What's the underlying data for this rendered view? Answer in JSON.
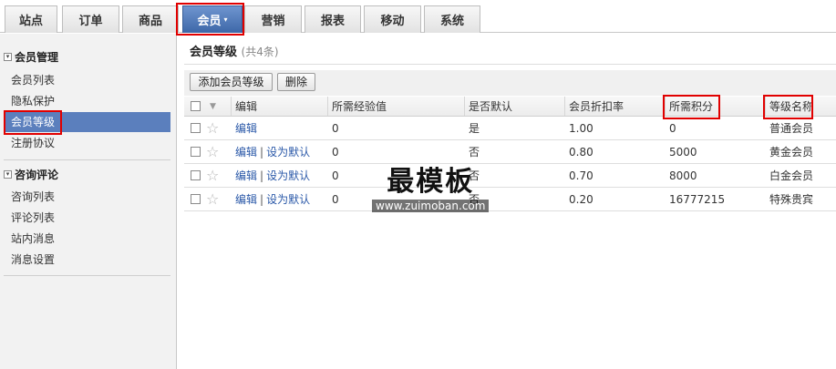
{
  "nav": {
    "tabs": [
      {
        "label": "站点"
      },
      {
        "label": "订单"
      },
      {
        "label": "商品"
      },
      {
        "label": "会员",
        "caret": "▾"
      },
      {
        "label": "营销"
      },
      {
        "label": "报表"
      },
      {
        "label": "移动"
      },
      {
        "label": "系统"
      }
    ],
    "active_index": 3
  },
  "sidebar": {
    "groups": [
      {
        "title": "会员管理",
        "toggle": "▾",
        "items": [
          {
            "label": "会员列表"
          },
          {
            "label": "隐私保护"
          },
          {
            "label": "会员等级",
            "active": true
          },
          {
            "label": "注册协议"
          }
        ]
      },
      {
        "title": "咨询评论",
        "toggle": "▾",
        "items": [
          {
            "label": "咨询列表"
          },
          {
            "label": "评论列表"
          },
          {
            "label": "站内消息"
          },
          {
            "label": "消息设置"
          }
        ]
      }
    ]
  },
  "main": {
    "title": "会员等级",
    "count_text": "(共4条)",
    "toolbar": {
      "add_label": "添加会员等级",
      "delete_label": "删除"
    },
    "table": {
      "columns": [
        "编辑",
        "所需经验值",
        "是否默认",
        "会员折扣率",
        "所需积分",
        "等级名称"
      ],
      "rows": [
        {
          "edit": "编辑",
          "set_default": "",
          "exp": "0",
          "is_default": "是",
          "discount": "1.00",
          "points": "0",
          "name": "普通会员"
        },
        {
          "edit": "编辑",
          "set_default": "设为默认",
          "exp": "0",
          "is_default": "否",
          "discount": "0.80",
          "points": "5000",
          "name": "黄金会员"
        },
        {
          "edit": "编辑",
          "set_default": "设为默认",
          "exp": "0",
          "is_default": "否",
          "discount": "0.70",
          "points": "8000",
          "name": "白金会员"
        },
        {
          "edit": "编辑",
          "set_default": "设为默认",
          "exp": "0",
          "is_default": "否",
          "discount": "0.20",
          "points": "16777215",
          "name": "特殊贵宾"
        }
      ]
    }
  },
  "watermark": {
    "title": "最模板",
    "url": "www.zuimoban.com"
  },
  "colors": {
    "highlight": "#e10000",
    "active_tab": "#4a73b4",
    "active_sidebar": "#5b7fbd",
    "link": "#2a58a8"
  }
}
